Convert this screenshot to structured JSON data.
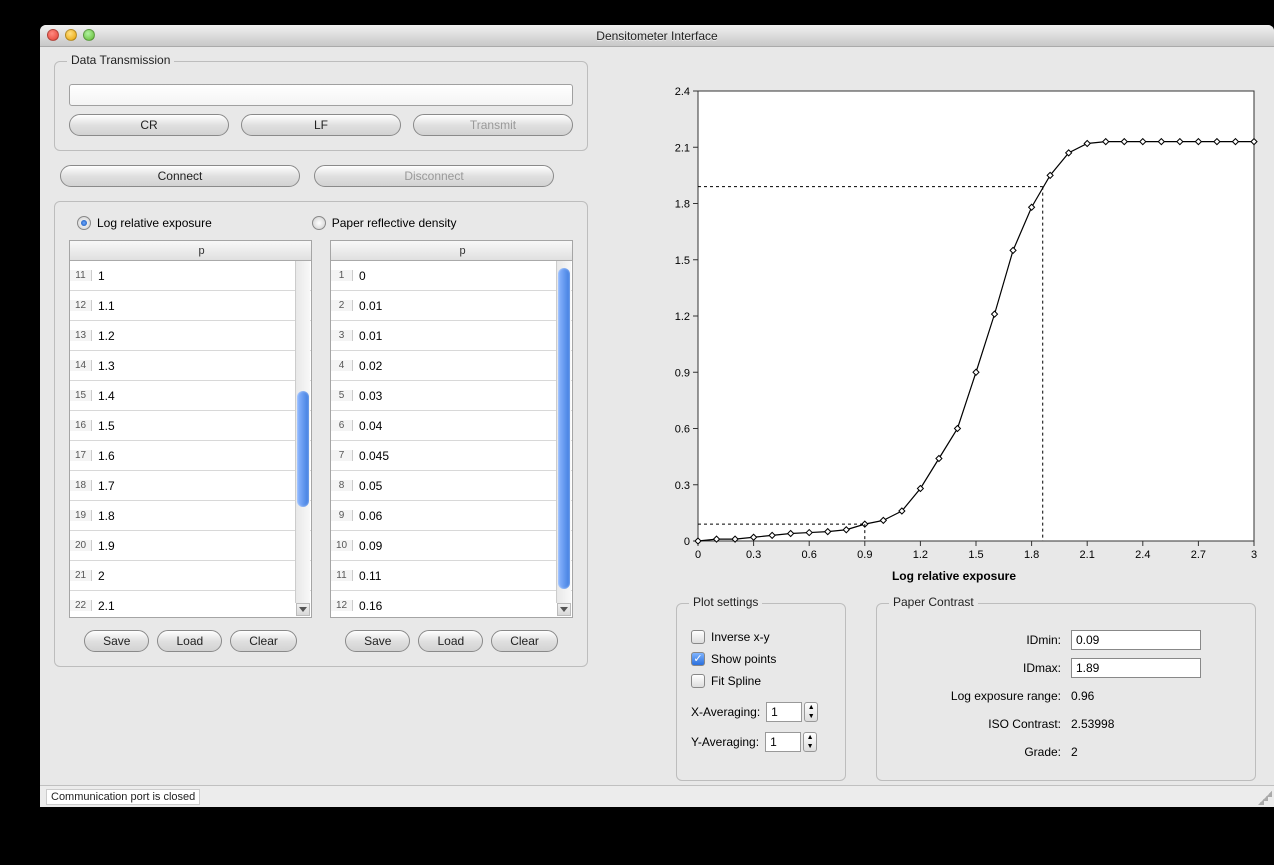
{
  "window": {
    "title": "Densitometer Interface"
  },
  "tx": {
    "label": "Data Transmission",
    "input": "",
    "cr": "CR",
    "lf": "LF",
    "transmit": "Transmit"
  },
  "conn": {
    "connect": "Connect",
    "disconnect": "Disconnect"
  },
  "radios": {
    "left": "Log relative exposure",
    "right": "Paper reflective density"
  },
  "table_header": "p",
  "left_table": [
    {
      "i": "11",
      "v": "1"
    },
    {
      "i": "12",
      "v": "1.1"
    },
    {
      "i": "13",
      "v": "1.2"
    },
    {
      "i": "14",
      "v": "1.3"
    },
    {
      "i": "15",
      "v": "1.4"
    },
    {
      "i": "16",
      "v": "1.5"
    },
    {
      "i": "17",
      "v": "1.6"
    },
    {
      "i": "18",
      "v": "1.7"
    },
    {
      "i": "19",
      "v": "1.8"
    },
    {
      "i": "20",
      "v": "1.9"
    },
    {
      "i": "21",
      "v": "2"
    },
    {
      "i": "22",
      "v": "2.1"
    }
  ],
  "right_table": [
    {
      "i": "1",
      "v": "0"
    },
    {
      "i": "2",
      "v": "0.01"
    },
    {
      "i": "3",
      "v": "0.01"
    },
    {
      "i": "4",
      "v": "0.02"
    },
    {
      "i": "5",
      "v": "0.03"
    },
    {
      "i": "6",
      "v": "0.04"
    },
    {
      "i": "7",
      "v": "0.045"
    },
    {
      "i": "8",
      "v": "0.05"
    },
    {
      "i": "9",
      "v": "0.06"
    },
    {
      "i": "10",
      "v": "0.09"
    },
    {
      "i": "11",
      "v": "0.11"
    },
    {
      "i": "12",
      "v": "0.16"
    }
  ],
  "btns": {
    "save": "Save",
    "load": "Load",
    "clear": "Clear"
  },
  "plot": {
    "label": "Plot settings",
    "inverse": "Inverse x-y",
    "show_points": "Show points",
    "fit_spline": "Fit Spline",
    "xavg_label": "X-Averaging:",
    "yavg_label": "Y-Averaging:",
    "xavg": "1",
    "yavg": "1"
  },
  "contrast": {
    "label": "Paper Contrast",
    "idmin_label": "IDmin:",
    "idmax_label": "IDmax:",
    "range_label": "Log exposure range:",
    "iso_label": "ISO Contrast:",
    "grade_label": "Grade:",
    "idmin": "0.09",
    "idmax": "1.89",
    "range": "0.96",
    "iso": "2.53998",
    "grade": "2"
  },
  "chart": {
    "xlabel": "Log relative exposure"
  },
  "status": "Communication port is closed",
  "chart_data": {
    "type": "line",
    "xlabel": "Log relative exposure",
    "ylabel": "",
    "xlim": [
      0,
      3
    ],
    "ylim": [
      0,
      2.4
    ],
    "x_ticks": [
      0,
      0.3,
      0.6,
      0.9,
      1.2,
      1.5,
      1.8,
      2.1,
      2.4,
      2.7,
      3
    ],
    "y_ticks": [
      0,
      0.3,
      0.6,
      0.9,
      1.2,
      1.5,
      1.8,
      2.1,
      2.4
    ],
    "x": [
      0,
      0.1,
      0.2,
      0.3,
      0.4,
      0.5,
      0.6,
      0.7,
      0.8,
      0.9,
      1,
      1.1,
      1.2,
      1.3,
      1.4,
      1.5,
      1.6,
      1.7,
      1.8,
      1.9,
      2,
      2.1,
      2.2,
      2.3,
      2.4,
      2.5,
      2.6,
      2.7,
      2.8,
      2.9,
      3
    ],
    "y": [
      0,
      0.01,
      0.01,
      0.02,
      0.03,
      0.04,
      0.045,
      0.05,
      0.06,
      0.09,
      0.11,
      0.16,
      0.28,
      0.44,
      0.6,
      0.9,
      1.21,
      1.55,
      1.78,
      1.95,
      2.07,
      2.12,
      2.13,
      2.13,
      2.13,
      2.13,
      2.13,
      2.13,
      2.13,
      2.13,
      2.13
    ],
    "ref_lines": {
      "idmin": {
        "y": 0.09,
        "x_at": 0.9
      },
      "idmax": {
        "y": 1.89,
        "x_at": 1.86
      }
    }
  }
}
